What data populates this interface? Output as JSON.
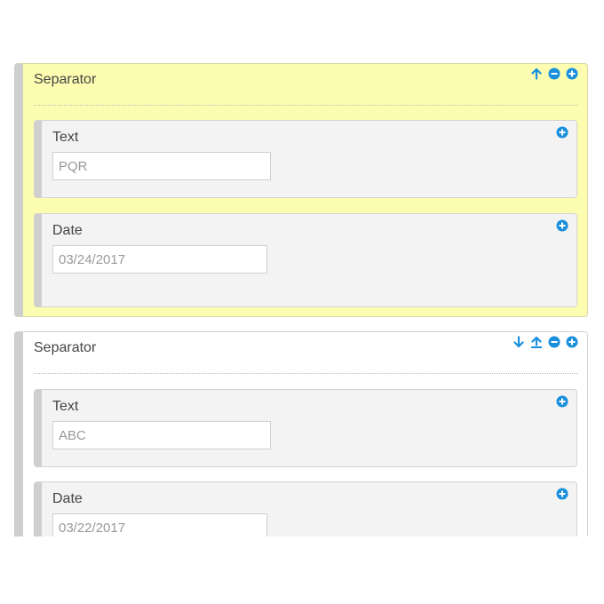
{
  "colors": {
    "accent": "#1a8fdd",
    "highlight_bg": "#fcfdb0",
    "field_bg": "#f3f3f3"
  },
  "sections": [
    {
      "title": "Separator",
      "actions": [
        "arrow-up-icon",
        "remove-icon",
        "add-icon"
      ],
      "fields": [
        {
          "label": "Text",
          "value": "PQR",
          "type": "text"
        },
        {
          "label": "Date",
          "value": "03/24/2017",
          "type": "date"
        }
      ]
    },
    {
      "title": "Separator",
      "actions": [
        "arrow-down-icon",
        "move-top-icon",
        "remove-icon",
        "add-icon"
      ],
      "fields": [
        {
          "label": "Text",
          "value": "ABC",
          "type": "text"
        },
        {
          "label": "Date",
          "value": "03/22/2017",
          "type": "date"
        }
      ]
    }
  ]
}
